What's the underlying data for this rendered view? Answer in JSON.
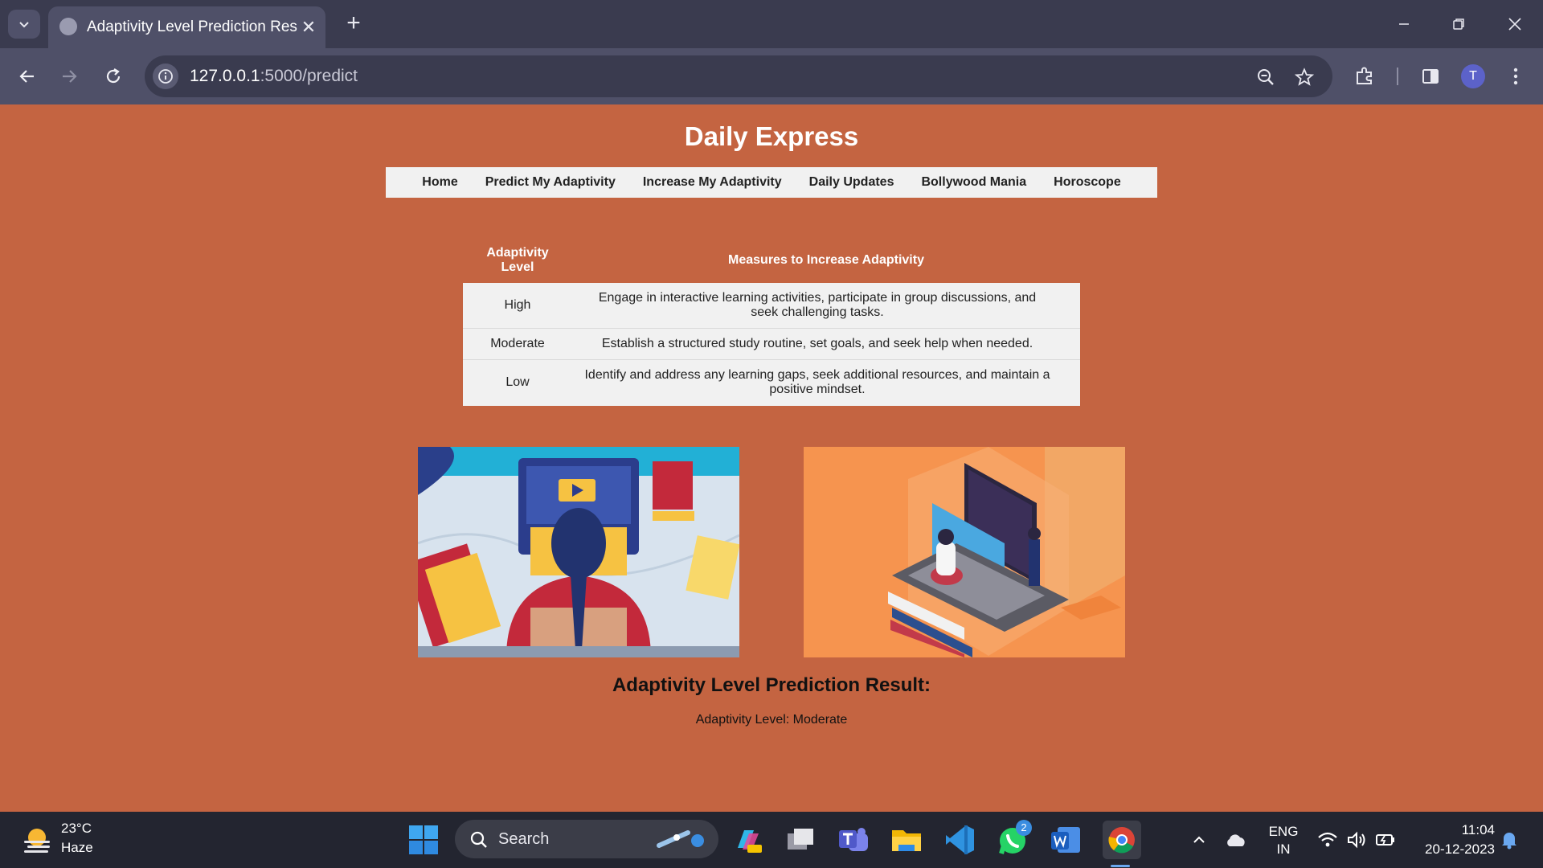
{
  "browser": {
    "tab_title": "Adaptivity Level Prediction Resu",
    "tab_close": "✕",
    "new_tab": "+",
    "url_host": "127.0.0.1",
    "url_rest": ":5000/predict"
  },
  "page": {
    "site_title": "Daily Express",
    "nav": [
      "Home",
      "Predict My Adaptivity",
      "Increase My Adaptivity",
      "Daily Updates",
      "Bollywood Mania",
      "Horoscope"
    ],
    "table": {
      "headers": [
        "Adaptivity Level",
        "Measures to Increase Adaptivity"
      ],
      "rows": [
        {
          "level": "High",
          "measure": "Engage in interactive learning activities, participate in group discussions, and seek challenging tasks."
        },
        {
          "level": "Moderate",
          "measure": "Establish a structured study routine, set goals, and seek help when needed."
        },
        {
          "level": "Low",
          "measure": "Identify and address any learning gaps, seek additional resources, and maintain a positive mindset."
        }
      ]
    },
    "result_title": "Adaptivity Level Prediction Result:",
    "result_text": "Adaptivity Level: Moderate"
  },
  "profile_initial": "T",
  "taskbar": {
    "weather_temp": "23°C",
    "weather_condition": "Haze",
    "search_label": "Search",
    "whatsapp_badge": "2",
    "language": "ENG",
    "region": "IN",
    "time": "11:04",
    "date": "20-12-2023"
  },
  "colors": {
    "page_background": "#c46441",
    "tabbar": "#3a3b4f",
    "toolbar": "#4f5068",
    "nav_background": "#f1f1f1",
    "taskbar": "#232530"
  }
}
